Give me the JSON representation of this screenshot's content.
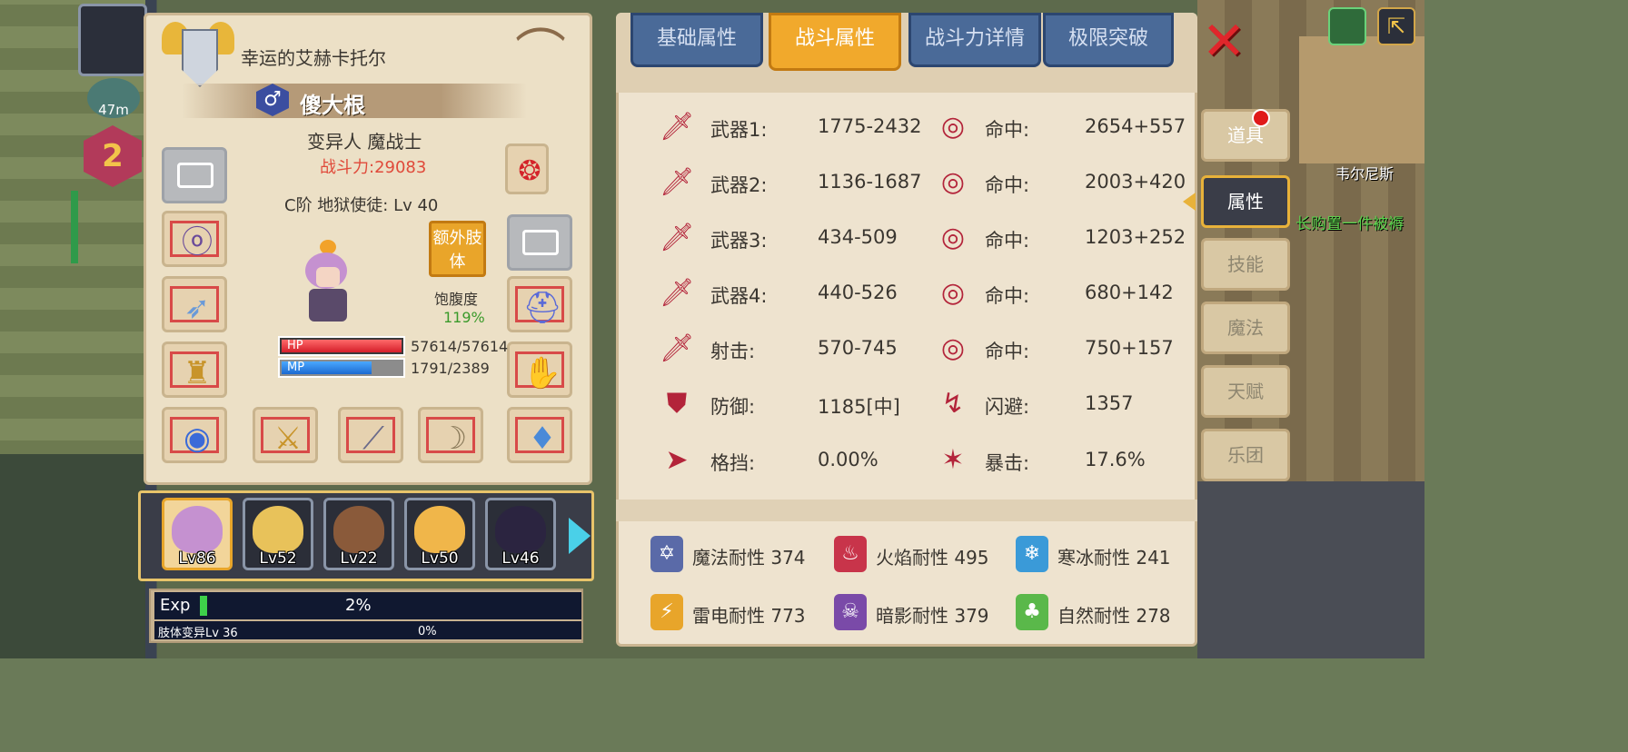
{
  "hud": {
    "distance": "47m",
    "level": "2",
    "location": "韦尔尼斯",
    "ticker": "长购置一件被褥"
  },
  "character": {
    "title": "幸运的艾赫卡托尔",
    "gender_symbol": "♂",
    "name": "傻大根",
    "class": "变异人 魔战士",
    "power": "战斗力:29083",
    "rank_line": "C阶 地狱使徒: Lv 40",
    "extra_limb": "额外肢体",
    "satiety_label": "饱腹度",
    "satiety_value": "119%",
    "hp_label": "HP",
    "hp_value": "57614/57614",
    "hp_fraction": 1.0,
    "mp_label": "MP",
    "mp_value": "1791/2389",
    "mp_fraction": 0.75
  },
  "party": [
    {
      "lv": "Lv86",
      "color": "#c591d0",
      "active": true
    },
    {
      "lv": "Lv52",
      "color": "#e8c25a",
      "active": false
    },
    {
      "lv": "Lv22",
      "color": "#8a5a3a",
      "active": false
    },
    {
      "lv": "Lv50",
      "color": "#f0b64a",
      "active": false
    },
    {
      "lv": "Lv46",
      "color": "#2b2440",
      "active": false
    }
  ],
  "exp": {
    "label": "Exp",
    "percent": "2%",
    "fraction": 0.02,
    "limb_label": "肢体变异Lv 36",
    "limb_percent": "0%"
  },
  "tabs": [
    "基础属性",
    "战斗属性",
    "战斗力详情",
    "极限突破"
  ],
  "active_tab": 1,
  "combat_stats": {
    "left": [
      {
        "label": "武器1:",
        "value": "1775-2432",
        "icon": "sword-icon"
      },
      {
        "label": "武器2:",
        "value": "1136-1687",
        "icon": "sword-icon"
      },
      {
        "label": "武器3:",
        "value": "434-509",
        "icon": "sword-icon"
      },
      {
        "label": "武器4:",
        "value": "440-526",
        "icon": "sword-icon"
      },
      {
        "label": "射击:",
        "value": "570-745",
        "icon": "sword-icon"
      },
      {
        "label": "防御:",
        "value": "1185[中]",
        "icon": "shield-icon"
      },
      {
        "label": "格挡:",
        "value": "0.00%",
        "icon": "parry-icon"
      }
    ],
    "right": [
      {
        "label": "命中:",
        "value": "2654+557",
        "icon": "target-icon"
      },
      {
        "label": "命中:",
        "value": "2003+420",
        "icon": "target-icon"
      },
      {
        "label": "命中:",
        "value": "1203+252",
        "icon": "target-icon"
      },
      {
        "label": "命中:",
        "value": "680+142",
        "icon": "target-icon"
      },
      {
        "label": "命中:",
        "value": "750+157",
        "icon": "target-icon"
      },
      {
        "label": "闪避:",
        "value": "1357",
        "icon": "dodge-icon"
      },
      {
        "label": "暴击:",
        "value": "17.6%",
        "icon": "critical-icon"
      }
    ]
  },
  "resistances": [
    {
      "text": "魔法耐性 374",
      "color": "#5a6aa8",
      "glyph": "✡"
    },
    {
      "text": "火焰耐性 495",
      "color": "#c8344a",
      "glyph": "♨"
    },
    {
      "text": "寒冰耐性 241",
      "color": "#3a9ad8",
      "glyph": "❄"
    },
    {
      "text": "雷电耐性 773",
      "color": "#e8a52a",
      "glyph": "⚡"
    },
    {
      "text": "暗影耐性 379",
      "color": "#7a4aa8",
      "glyph": "☠"
    },
    {
      "text": "自然耐性 278",
      "color": "#5ab84a",
      "glyph": "♣"
    }
  ],
  "side_menu": [
    "道具",
    "属性",
    "技能",
    "魔法",
    "天赋",
    "乐团"
  ],
  "side_active": 1
}
